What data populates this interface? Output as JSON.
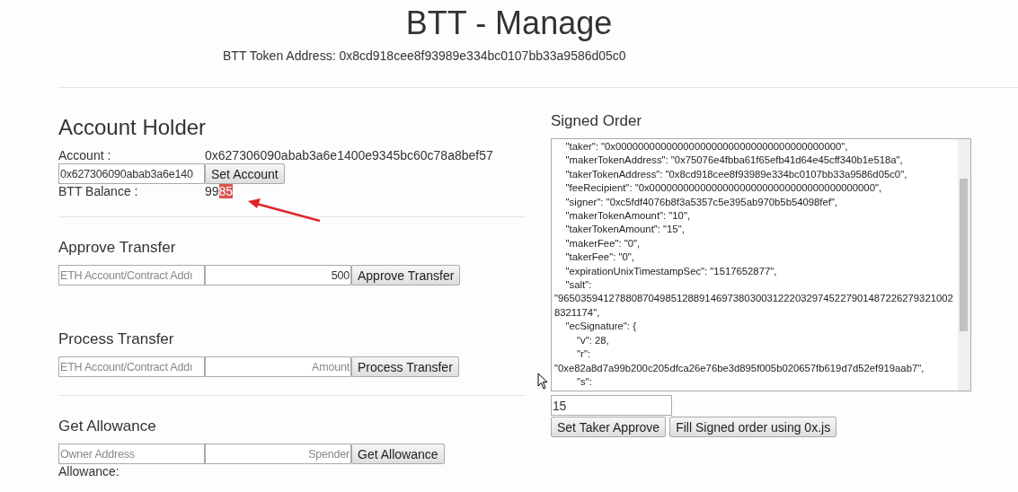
{
  "title": "BTT - Manage",
  "token_address": "BTT Token Address: 0x8cd918cee8f93989e334bc0107bb33a9586d05c0",
  "account_holder": {
    "heading": "Account Holder",
    "account_label": "Account :",
    "account_value": "0x627306090abab3a6e1400e9345bc60c78a8bef57",
    "account_input": "0x627306090abab3a6e140",
    "set_button": "Set Account",
    "balance_label": "BTT Balance :",
    "balance": {
      "plain": "99",
      "selected": "85"
    }
  },
  "sections": [
    {
      "heading": "Approve Transfer",
      "fields": [
        {
          "placeholder": "ETH Account/Contract Addı"
        },
        {
          "value": "500"
        }
      ],
      "button": "Approve Transfer"
    },
    {
      "heading": "Process Transfer",
      "fields": [
        {
          "placeholder": "ETH Account/Contract Addı"
        },
        {
          "placeholder": "Amount"
        }
      ],
      "button": "Process Transfer"
    },
    {
      "heading": "Get Allowance",
      "fields": [
        {
          "placeholder": "Owner Address"
        },
        {
          "placeholder": "Spender"
        }
      ],
      "button": "Get Allowance",
      "result": "Allowance:"
    }
  ],
  "signed_order": {
    "heading": "Signed Order",
    "lines": [
      "    \"taker\": \"0x0000000000000000000000000000000000000000\",",
      "    \"makerTokenAddress\": \"0x75076e4fbba61f65efb41d64e45cff340b1e518a\",",
      "    \"takerTokenAddress\": \"0x8cd918cee8f93989e334bc0107bb33a9586d05c0\",",
      "    \"feeRecipient\": \"0x0000000000000000000000000000000000000000\",",
      "    \"signer\": \"0xc5fdf4076b8f3a5357c5e395ab970b5b54098fef\",",
      "    \"makerTokenAmount\": \"10\",",
      "    \"takerTokenAmount\": \"15\",",
      "    \"makerFee\": \"0\",",
      "    \"takerFee\": \"0\",",
      "    \"expirationUnixTimestampSec\": \"1517652877\",",
      "    \"salt\": \"96503594127880870498512889146973803003122203297452279014872262793210028321174\",",
      "    \"ecSignature\": {",
      "        \"v\": 28,",
      "        \"r\": \"0xe82a8d7a99b200c205dfca26e76be3d895f005b020657fb619d7d52ef919aab7\",",
      "        \"s\":"
    ],
    "amount_input": "15",
    "buttons": [
      "Set Taker Approve",
      "Fill Signed order using 0x.js"
    ]
  }
}
